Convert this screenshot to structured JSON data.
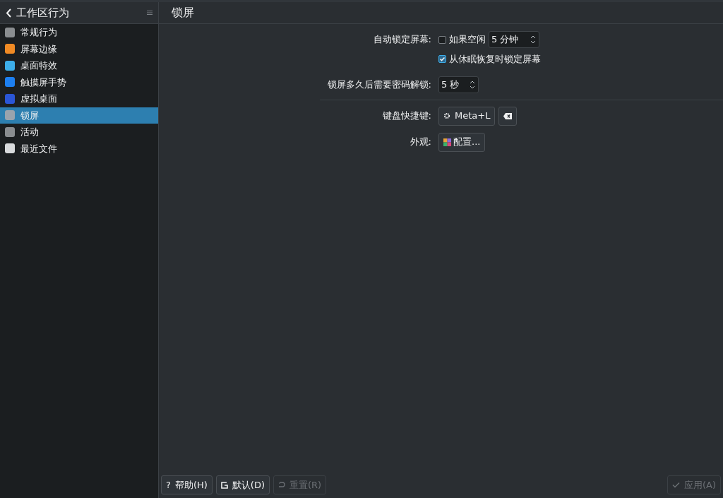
{
  "sidebar": {
    "title": "工作区行为",
    "items": [
      {
        "label": "常规行为",
        "selected": false,
        "color": "#8a8d90"
      },
      {
        "label": "屏幕边缘",
        "selected": false,
        "color": "#f08a24"
      },
      {
        "label": "桌面特效",
        "selected": false,
        "color": "#3daee9"
      },
      {
        "label": "触摸屏手势",
        "selected": false,
        "color": "#1d7ff0"
      },
      {
        "label": "虚拟桌面",
        "selected": false,
        "color": "#2b56d6"
      },
      {
        "label": "锁屏",
        "selected": true,
        "color": "#9aa3ad"
      },
      {
        "label": "活动",
        "selected": false,
        "color": "#8a8d90"
      },
      {
        "label": "最近文件",
        "selected": false,
        "color": "#d8dadc"
      }
    ]
  },
  "page_title": "锁屏",
  "form": {
    "auto_lock": {
      "label": "自动锁定屏幕:",
      "idle_label": "如果空闲",
      "idle_checked": false,
      "idle_value": "5 分钟",
      "resume_label": "从休眠恢复时锁定屏幕",
      "resume_checked": true
    },
    "password": {
      "label": "锁屏多久后需要密码解锁:",
      "value": "5 秒"
    },
    "shortcut": {
      "label": "键盘快捷键:",
      "value": "Meta+L"
    },
    "appearance": {
      "label": "外观:",
      "button": "配置..."
    }
  },
  "footer": {
    "help": {
      "icon": "?",
      "label": "帮助(H)",
      "disabled": false
    },
    "defaults": {
      "label": "默认(D)",
      "disabled": false
    },
    "reset": {
      "label": "重置(R)",
      "disabled": true
    },
    "apply": {
      "label": "应用(A)",
      "disabled": true
    }
  }
}
